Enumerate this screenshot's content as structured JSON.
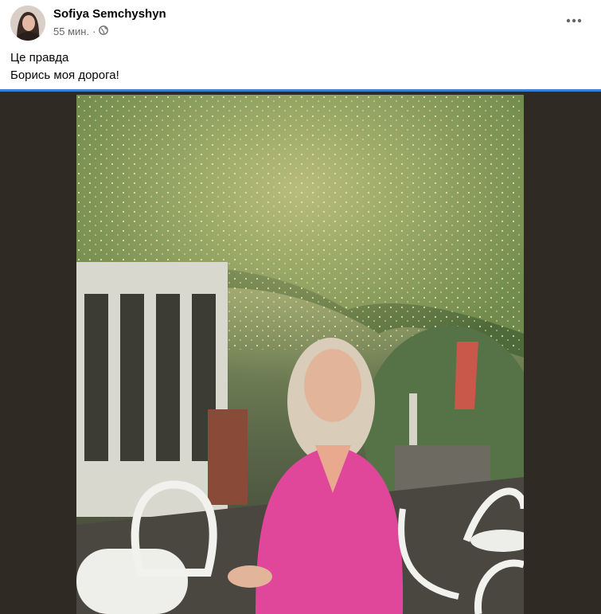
{
  "post": {
    "author": "Sofiya Semchyshyn",
    "time": "55 мин.",
    "separator": "·",
    "audience_icon": "globe-icon",
    "text_lines": [
      "Це правда",
      "Борись моя дорога!"
    ]
  },
  "icons": {
    "more": "more-options-icon",
    "avatar": "avatar"
  },
  "colors": {
    "accent": "#3f7fd5",
    "photo_background": "#2f2b24",
    "jacket": "#e0479b"
  }
}
